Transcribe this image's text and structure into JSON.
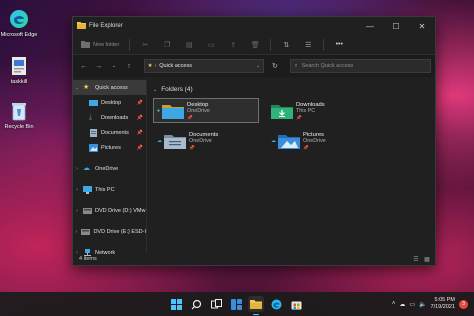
{
  "desktop": {
    "icons": [
      {
        "label": "Microsoft Edge",
        "icon": "edge-icon"
      },
      {
        "label": "taskkill",
        "icon": "file-icon"
      },
      {
        "label": "Recycle Bin",
        "icon": "recycle-bin-icon"
      }
    ]
  },
  "window": {
    "title": "File Explorer",
    "controls": {
      "minimize": "—",
      "maximize": "☐",
      "close": "✕"
    }
  },
  "toolbar": {
    "new_folder_label": "New folder",
    "icons": [
      "cut-icon",
      "copy-icon",
      "paste-icon",
      "rename-icon",
      "share-icon",
      "delete-icon",
      "sort-icon",
      "view-icon",
      "more-icon"
    ]
  },
  "address": {
    "location": "Quick access",
    "search_placeholder": "Search Quick access"
  },
  "sidebar": {
    "items": [
      {
        "label": "Quick access",
        "icon": "star-icon",
        "level": 0,
        "expanded": true,
        "selected": true
      },
      {
        "label": "Desktop",
        "icon": "desktop-folder-icon",
        "level": 1,
        "pinned": true
      },
      {
        "label": "Downloads",
        "icon": "download-icon",
        "level": 1,
        "pinned": true
      },
      {
        "label": "Documents",
        "icon": "documents-icon",
        "level": 1,
        "pinned": true
      },
      {
        "label": "Pictures",
        "icon": "pictures-icon",
        "level": 1,
        "pinned": true
      },
      {
        "label": "OneDrive",
        "icon": "cloud-icon",
        "level": 0
      },
      {
        "label": "This PC",
        "icon": "computer-icon",
        "level": 0
      },
      {
        "label": "DVD Drive (D:) VMw",
        "icon": "dvd-icon",
        "level": 0
      },
      {
        "label": "DVD Drive (E:) ESD-I",
        "icon": "dvd-icon",
        "level": 0
      },
      {
        "label": "Network",
        "icon": "network-icon",
        "level": 0
      }
    ]
  },
  "content": {
    "group_title": "Folders (4)",
    "folders": [
      {
        "name": "Desktop",
        "location": "OneDrive",
        "icon": "desktop-folder-icon",
        "selected": true
      },
      {
        "name": "Downloads",
        "location": "This PC",
        "icon": "download-folder-icon"
      },
      {
        "name": "Documents",
        "location": "OneDrive",
        "icon": "documents-folder-icon"
      },
      {
        "name": "Pictures",
        "location": "OneDrive",
        "icon": "pictures-folder-icon"
      }
    ]
  },
  "status": {
    "items_count": "4 items"
  },
  "taskbar": {
    "apps": [
      "start-icon",
      "search-icon",
      "task-view-icon",
      "widgets-icon",
      "file-explorer-icon",
      "edge-icon",
      "store-icon"
    ],
    "active_app": "file-explorer-icon",
    "time": "5:05 PM",
    "date": "7/19/2021",
    "notification_count": "3"
  },
  "colors": {
    "accent": "#60cdff",
    "folder_yellow": "#f2c94c",
    "folder_blue": "#3fa7e6",
    "downloads_green": "#2fb37a",
    "window_bg": "#202020"
  }
}
